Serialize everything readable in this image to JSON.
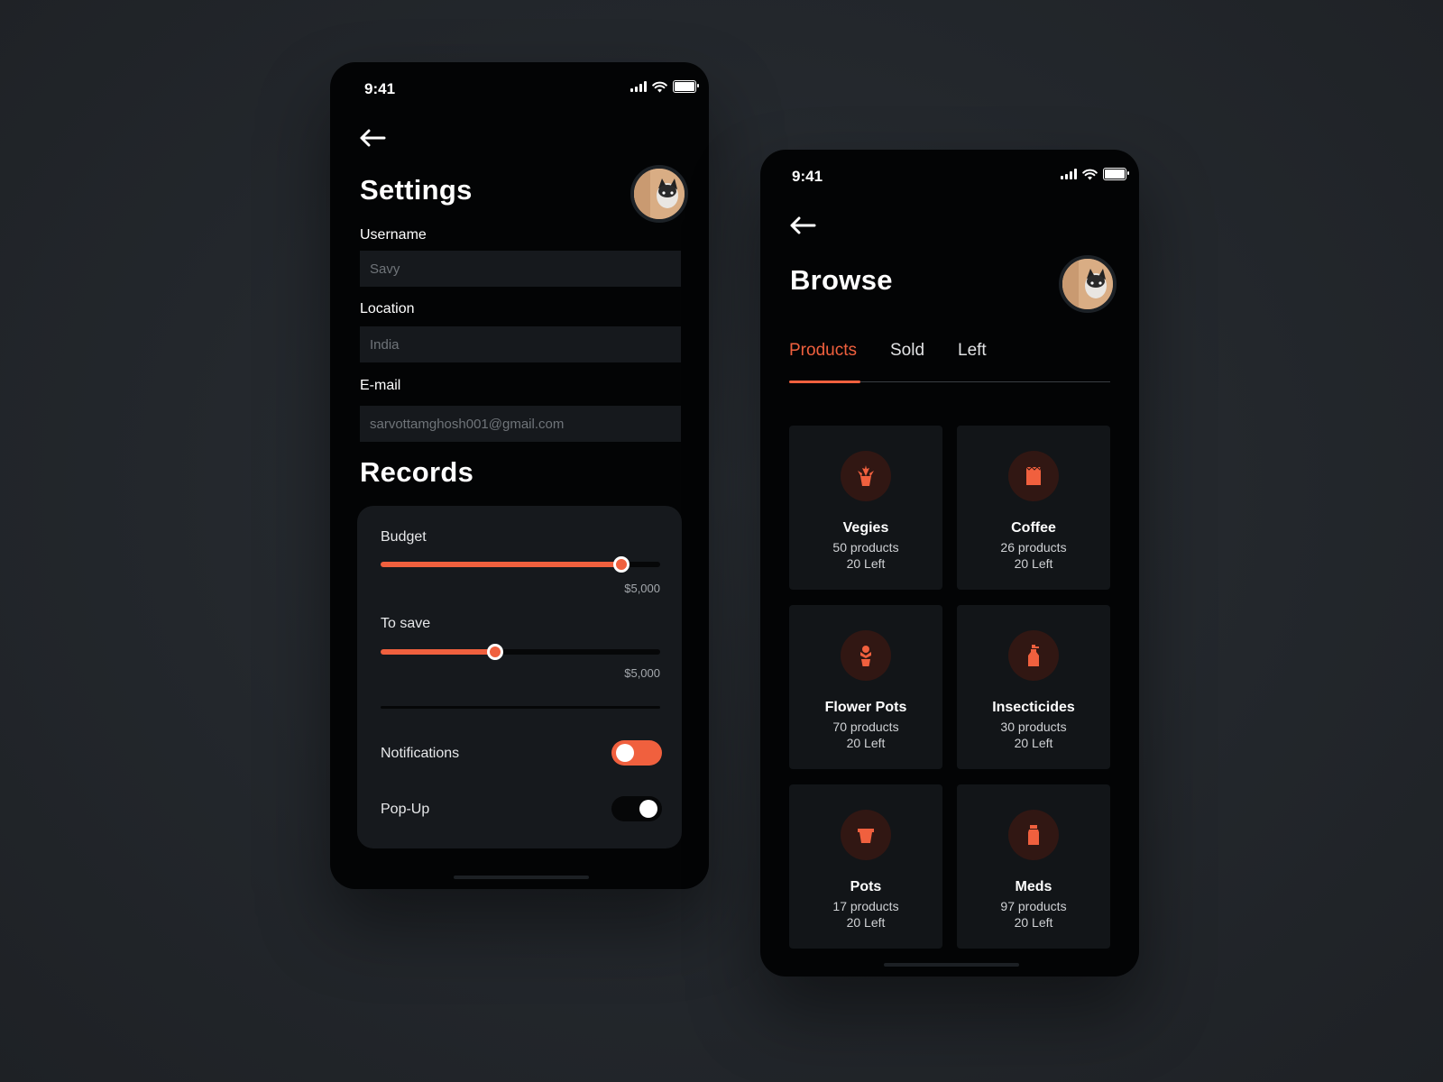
{
  "colors": {
    "accent": "#f0603e",
    "phone_bg": "#030405",
    "field_bg": "#16191d",
    "card_bg": "#121518"
  },
  "settings_screen": {
    "status_time": "9:41",
    "title": "Settings",
    "fields": [
      {
        "label": "Username",
        "placeholder": "Savy"
      },
      {
        "label": "Location",
        "placeholder": "India"
      },
      {
        "label": "E-mail",
        "placeholder": "sarvottamghosh001@gmail.com"
      }
    ],
    "records_title": "Records",
    "sliders": [
      {
        "label": "Budget",
        "value_text": "$5,000",
        "fraction": 0.86
      },
      {
        "label": "To save",
        "value_text": "$5,000",
        "fraction": 0.41
      }
    ],
    "toggles": [
      {
        "label": "Notifications",
        "on": true
      },
      {
        "label": "Pop-Up",
        "on": false
      }
    ]
  },
  "browse_screen": {
    "status_time": "9:41",
    "title": "Browse",
    "tabs": [
      "Products",
      "Sold",
      "Left"
    ],
    "active_tab": "Products",
    "categories": [
      {
        "name": "Vegies",
        "products": "50 products",
        "left": "20 Left",
        "icon": "plant-icon"
      },
      {
        "name": "Coffee",
        "products": "26 products",
        "left": "20 Left",
        "icon": "coffee-bag-icon"
      },
      {
        "name": "Flower Pots",
        "products": "70 products",
        "left": "20 Left",
        "icon": "flower-pot-icon"
      },
      {
        "name": "Insecticides",
        "products": "30 products",
        "left": "20 Left",
        "icon": "spray-bottle-icon"
      },
      {
        "name": "Pots",
        "products": "17 products",
        "left": "20 Left",
        "icon": "pot-icon"
      },
      {
        "name": "Meds",
        "products": "97 products",
        "left": "20 Left",
        "icon": "medicine-bottle-icon"
      }
    ]
  }
}
